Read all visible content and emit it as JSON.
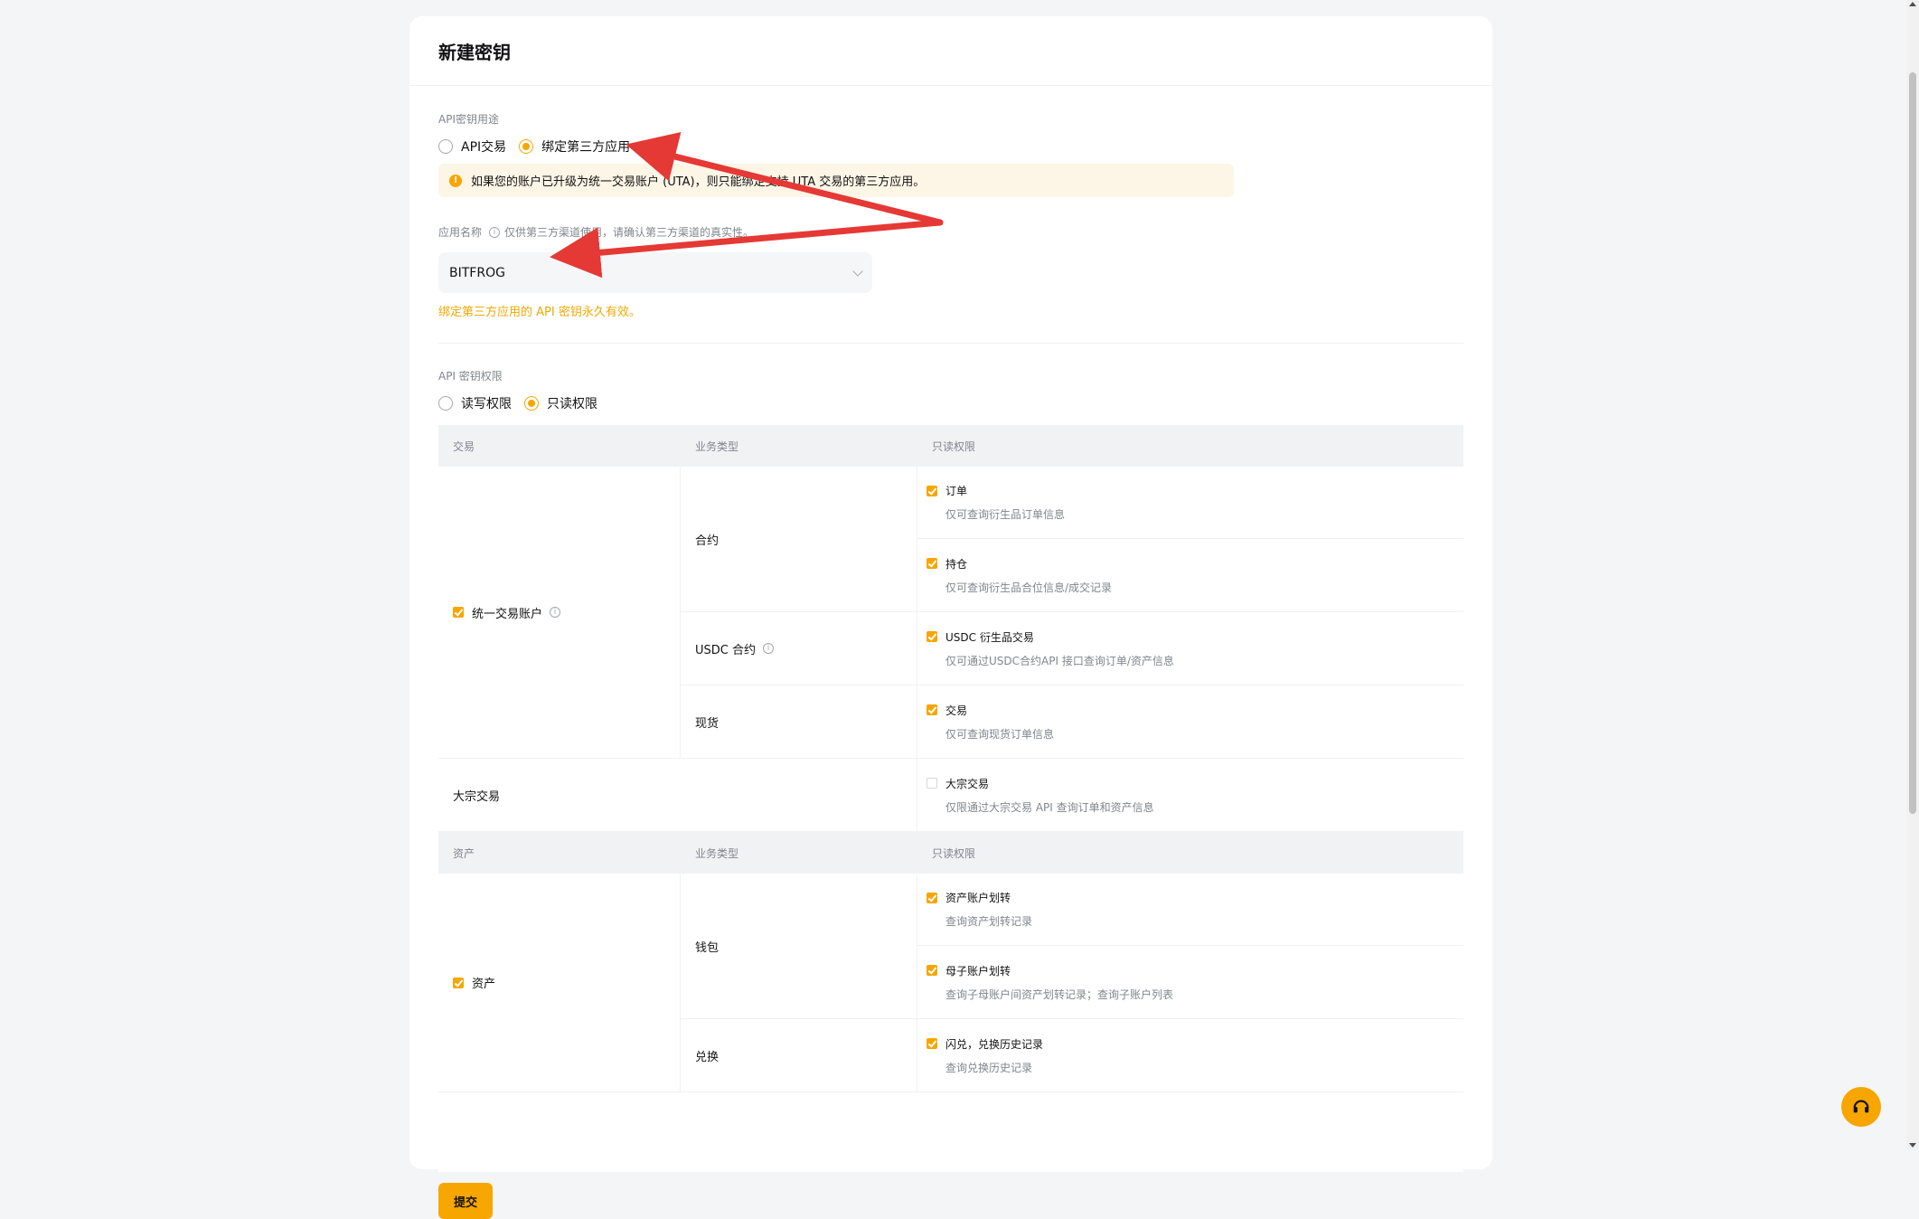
{
  "card": {
    "title": "新建密钥"
  },
  "purpose": {
    "label": "API密钥用途",
    "options": [
      "API交易",
      "绑定第三方应用"
    ],
    "selected": "绑定第三方应用",
    "notice": "如果您的账户已升级为统一交易账户 (UTA)，则只能绑定支持 UTA 交易的第三方应用。"
  },
  "app": {
    "label": "应用名称",
    "tip": "仅供第三方渠道使用，请确认第三方渠道的真实性。",
    "value": "BITFROG",
    "hint": "绑定第三方应用的 API 密钥永久有效。"
  },
  "permissions": {
    "label": "API 密钥权限",
    "options": [
      "读写权限",
      "只读权限"
    ],
    "selected": "只读权限",
    "trade_header": [
      "交易",
      "业务类型",
      "只读权限"
    ],
    "uta": {
      "label": "统一交易账户",
      "checked": true,
      "subs": [
        {
          "type": "合约",
          "perms": [
            {
              "title": "订单",
              "desc": "仅可查询衍生品订单信息",
              "checked": true
            },
            {
              "title": "持仓",
              "desc": "仅可查询衍生品合位信息/成交记录",
              "checked": true
            }
          ]
        },
        {
          "type": "USDC 合约",
          "perms": [
            {
              "title": "USDC 衍生品交易",
              "desc": "仅可通过USDC合约API 接口查询订单/资产信息",
              "checked": true
            }
          ]
        },
        {
          "type": "现货",
          "perms": [
            {
              "title": "交易",
              "desc": "仅可查询现货订单信息",
              "checked": true
            }
          ]
        }
      ]
    },
    "bulk": {
      "label": "大宗交易",
      "perm": {
        "title": "大宗交易",
        "desc": "仅限通过大宗交易 API 查询订单和资产信息",
        "checked": false
      }
    },
    "asset_header": [
      "资产",
      "业务类型",
      "只读权限"
    ],
    "assets": {
      "label": "资产",
      "checked": true,
      "subs": [
        {
          "type": "钱包",
          "perms": [
            {
              "title": "资产账户划转",
              "desc": "查询资产划转记录",
              "checked": true
            },
            {
              "title": "母子账户划转",
              "desc": "查询子母账户间资产划转记录；查询子账户列表",
              "checked": true
            }
          ]
        },
        {
          "type": "兑换",
          "perms": [
            {
              "title": "闪兑，兑换历史记录",
              "desc": "查询兑换历史记录",
              "checked": true
            }
          ]
        }
      ]
    }
  },
  "submit_label": "提交",
  "colors": {
    "accent": "#f7a600",
    "annotation_arrow": "#e53935"
  },
  "icons": {
    "support": "headset-icon",
    "info": "info-icon",
    "warning": "warning-icon"
  }
}
